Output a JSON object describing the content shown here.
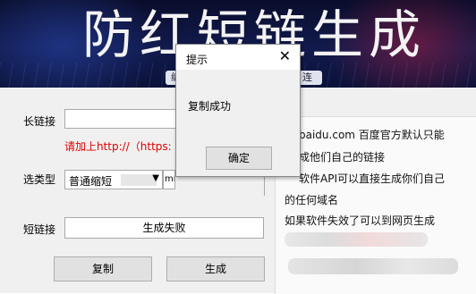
{
  "banner": {
    "title": "防红短链生成",
    "ribbon_left": "编",
    "ribbon_right": "连"
  },
  "form": {
    "long_label": "长链接",
    "long_value": "",
    "hint": "请加上http://（https:",
    "type_label": "选类型",
    "type_selected": "普通缩短",
    "type_extra": "mr",
    "short_label": "短链接",
    "short_value": "生成失败",
    "copy_button": "复制",
    "generate_button": "生成"
  },
  "info_panel": {
    "line1": "baidu.com 百度官方默认只能",
    "line2": "成他们自己的链接",
    "line3": "软件API可以直接生成你们自己",
    "line4": "的任何域名",
    "line5": "如果软件失效了可以到网页生成"
  },
  "dialog": {
    "title": "提示",
    "close_glyph": "✕",
    "message": "复制成功",
    "ok_button": "确定"
  },
  "colors": {
    "hint_red": "#e00000",
    "banner_dark": "#0a0d2b"
  }
}
